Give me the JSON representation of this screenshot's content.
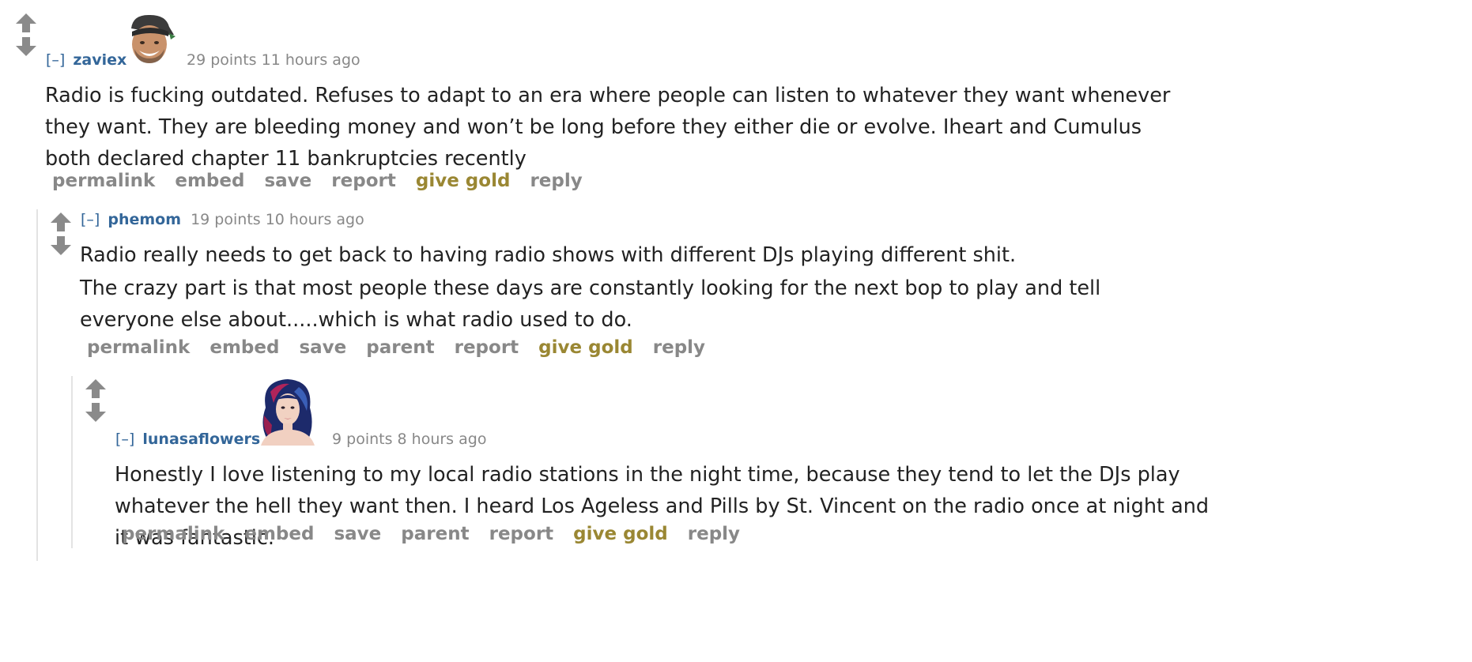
{
  "comments": [
    {
      "collapse": "[–]",
      "author": "zaviex",
      "score": "29 points",
      "time": "11 hours ago",
      "paragraphs": [
        "Radio is fucking outdated. Refuses to adapt to an era where people can listen to whatever they want whenever they want. They are bleeding money and won’t be long before they either die or evolve. Iheart and Cumulus both declared chapter 11 bankruptcies recently"
      ],
      "buttons": [
        "permalink",
        "embed",
        "save",
        "report",
        "give gold",
        "reply"
      ]
    },
    {
      "collapse": "[–]",
      "author": "phemom",
      "score": "19 points",
      "time": "10 hours ago",
      "paragraphs": [
        "Radio really needs to get back to having radio shows with different DJs playing different shit.",
        "The crazy part is that most people these days are constantly looking for the next bop to play and tell everyone else about.....which is what radio used to do."
      ],
      "buttons": [
        "permalink",
        "embed",
        "save",
        "parent",
        "report",
        "give gold",
        "reply"
      ]
    },
    {
      "collapse": "[–]",
      "author": "lunasaflowers",
      "score": "9 points",
      "time": "8 hours ago",
      "paragraphs": [
        "Honestly I love listening to my local radio stations in the night time, because they tend to let the DJs play whatever the hell they want then. I heard Los Ageless and Pills by St. Vincent on the radio once at night and it was fantastic."
      ],
      "buttons": [
        "permalink",
        "embed",
        "save",
        "parent",
        "report",
        "give gold",
        "reply"
      ]
    }
  ],
  "colors": {
    "author": "#336699",
    "meta": "#888888",
    "gold": "#9a8733",
    "arrow": "#8a8a8a",
    "thread_line": "#e3e3e3"
  },
  "icons": {
    "upvote": "upvote-arrow-icon",
    "downvote": "downvote-arrow-icon"
  }
}
